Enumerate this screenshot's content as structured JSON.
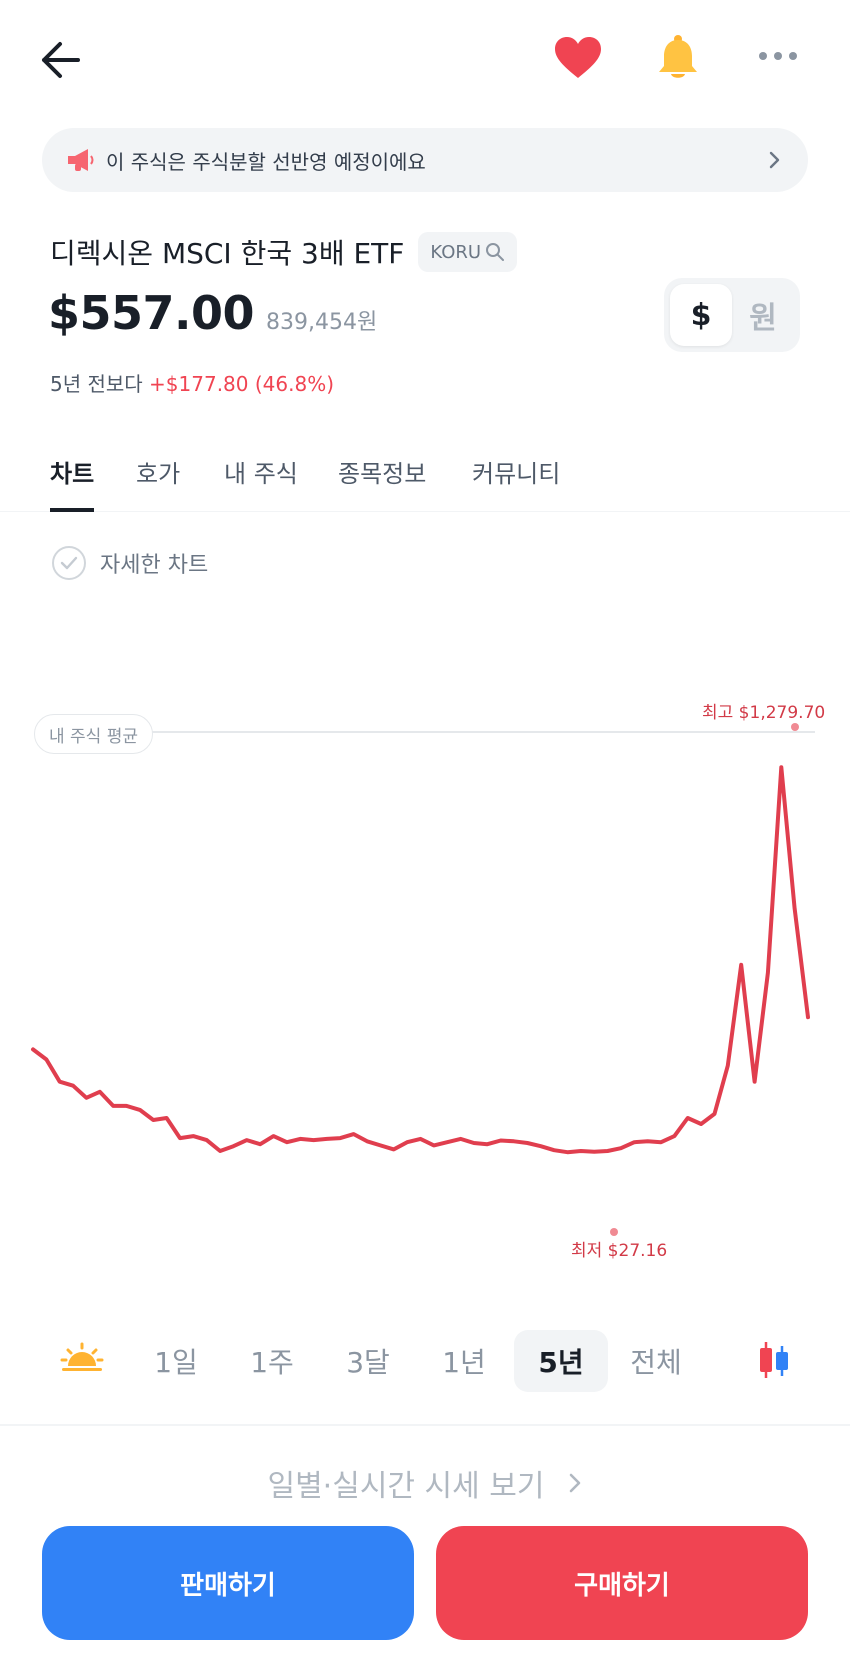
{
  "banner": {
    "text": "이 주식은 주식분할 선반영 예정이에요"
  },
  "stock": {
    "name": "디렉시온 MSCI 한국 3배 ETF",
    "ticker": "KORU",
    "price": "$557.00",
    "price_krw": "839,454원",
    "change_prefix": "5년 전보다",
    "change_value": "+$177.80 (46.8%)"
  },
  "currency_toggle": {
    "usd": "$",
    "krw": "원",
    "selected": "usd"
  },
  "tabs": [
    {
      "label": "차트",
      "active": true
    },
    {
      "label": "호가",
      "active": false
    },
    {
      "label": "내 주식",
      "active": false
    },
    {
      "label": "종목정보",
      "active": false
    },
    {
      "label": "커뮤니티",
      "active": false
    }
  ],
  "detail_chart_label": "자세한 차트",
  "chart": {
    "avg_label": "내 주식 평균",
    "high_label": "최고 $1,279.70",
    "low_label": "최저 $27.16"
  },
  "chart_data": {
    "type": "line",
    "color": "#e03e4e",
    "high": 1279.7,
    "low": 27.16,
    "last": 557.0,
    "values": [
      480,
      455,
      400,
      390,
      360,
      375,
      340,
      340,
      330,
      305,
      310,
      260,
      265,
      255,
      228,
      240,
      255,
      245,
      265,
      250,
      258,
      255,
      258,
      260,
      270,
      252,
      242,
      232,
      250,
      258,
      242,
      250,
      258,
      248,
      245,
      254,
      252,
      248,
      240,
      230,
      225,
      228,
      226,
      228,
      235,
      250,
      252,
      250,
      265,
      310,
      295,
      320,
      440,
      690,
      400,
      670,
      1180,
      830,
      560
    ]
  },
  "periods": [
    {
      "label": "1일",
      "active": false
    },
    {
      "label": "1주",
      "active": false
    },
    {
      "label": "3달",
      "active": false
    },
    {
      "label": "1년",
      "active": false
    },
    {
      "label": "5년",
      "active": true
    },
    {
      "label": "전체",
      "active": false
    }
  ],
  "daily_link": "일별·실시간 시세 보기",
  "buttons": {
    "sell": "판매하기",
    "buy": "구매하기"
  },
  "colors": {
    "sell": "#3182f6",
    "buy": "#f04452",
    "up": "#f04452",
    "line": "#e03e4e"
  },
  "icons": [
    "back-arrow-icon",
    "heart-icon",
    "bell-icon",
    "more-icon",
    "megaphone-icon",
    "search-icon",
    "check-icon",
    "sun-icon",
    "candlestick-icon",
    "chevron-right-icon"
  ]
}
